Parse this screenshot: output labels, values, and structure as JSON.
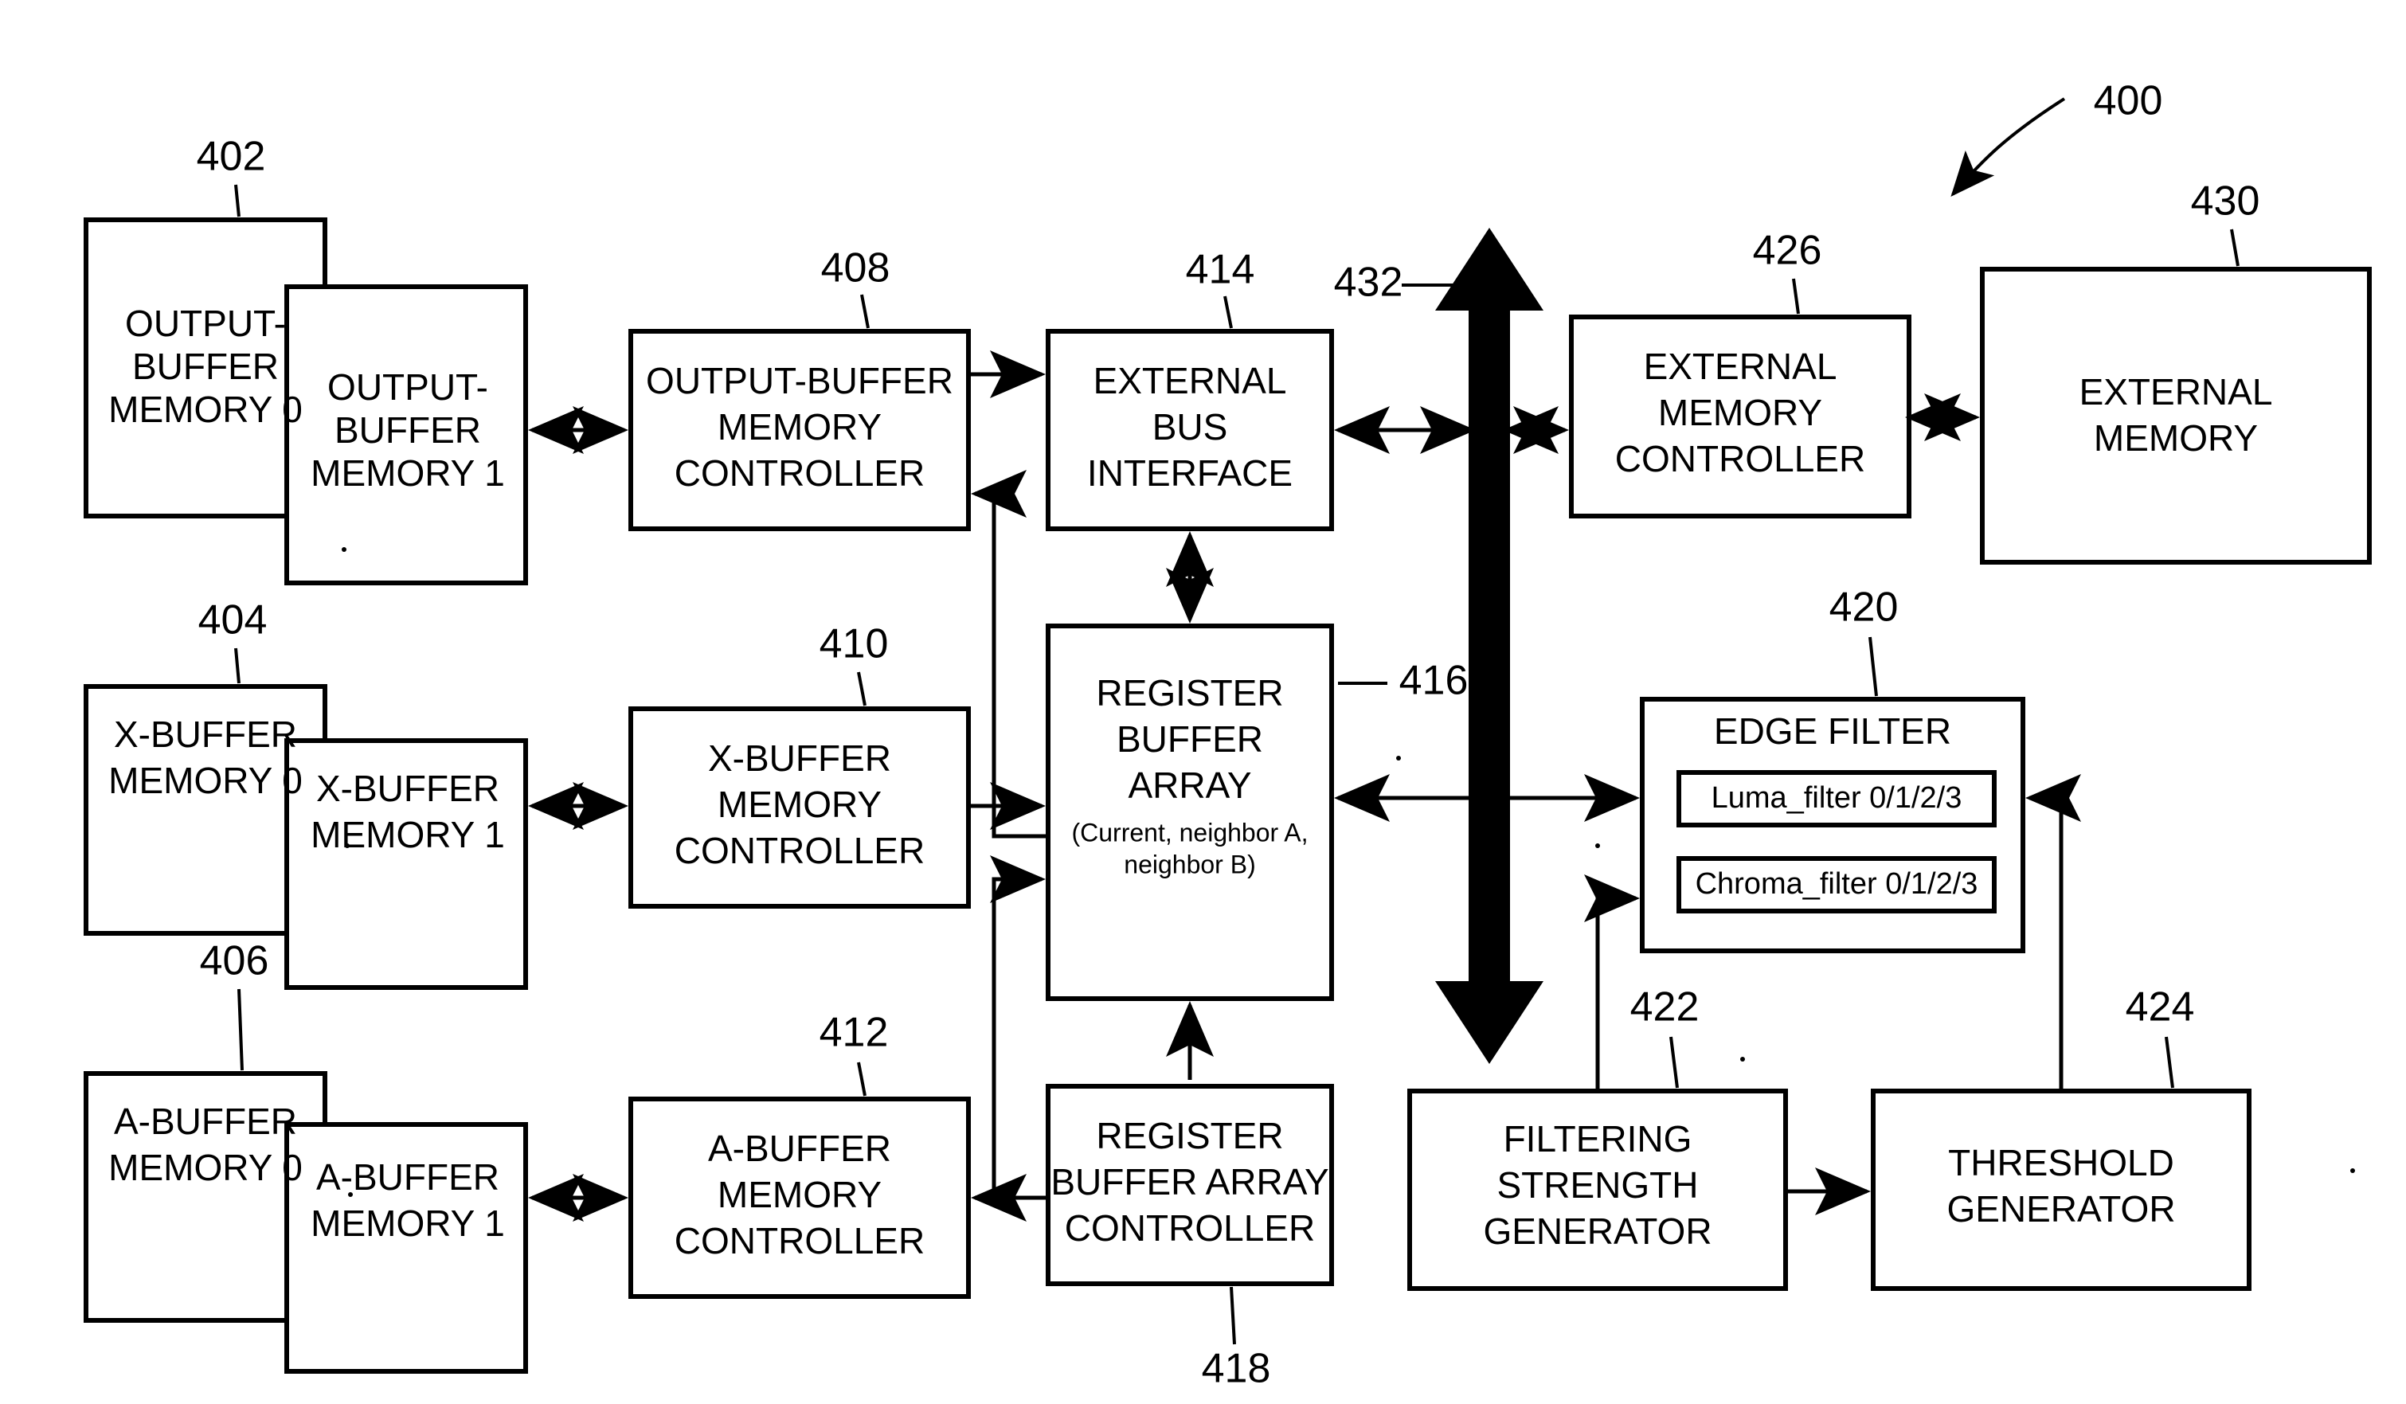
{
  "figure": {
    "overall_ref": "400",
    "type": "patent-block-diagram",
    "title_text": ""
  },
  "blocks": [
    {
      "id": "output_buffer_memory_0",
      "label_lines": [
        "OUTPUT-",
        "BUFFER",
        "MEMORY 0"
      ],
      "ref": "402"
    },
    {
      "id": "output_buffer_memory_1",
      "label_lines": [
        "OUTPUT-",
        "BUFFER",
        "MEMORY 1"
      ],
      "ref": ""
    },
    {
      "id": "output_buffer_memory_controller",
      "label_lines": [
        "OUTPUT-BUFFER",
        "MEMORY",
        "CONTROLLER"
      ],
      "ref": "408"
    },
    {
      "id": "external_bus_interface",
      "label_lines": [
        "EXTERNAL",
        "BUS",
        "INTERFACE"
      ],
      "ref": "414"
    },
    {
      "id": "external_memory_controller",
      "label_lines": [
        "EXTERNAL",
        "MEMORY",
        "CONTROLLER"
      ],
      "ref": "426"
    },
    {
      "id": "external_memory",
      "label_lines": [
        "EXTERNAL",
        "MEMORY"
      ],
      "ref": "430"
    },
    {
      "id": "x_buffer_memory_0",
      "label_lines": [
        "X-BUFFER",
        "MEMORY 0"
      ],
      "ref": "404"
    },
    {
      "id": "x_buffer_memory_1",
      "label_lines": [
        "X-BUFFER",
        "MEMORY 1"
      ],
      "ref": ""
    },
    {
      "id": "x_buffer_memory_controller",
      "label_lines": [
        "X-BUFFER",
        "MEMORY",
        "CONTROLLER"
      ],
      "ref": "410"
    },
    {
      "id": "register_buffer_array",
      "label_lines": [
        "REGISTER",
        "BUFFER",
        "ARRAY"
      ],
      "sub_lines": [
        "(Current, neighbor A,",
        "neighbor B)"
      ],
      "ref": "416"
    },
    {
      "id": "edge_filter",
      "label_lines": [
        "EDGE FILTER"
      ],
      "ref": "420"
    },
    {
      "id": "luma_filter",
      "label_lines": [
        "Luma_filter 0/1/2/3"
      ],
      "ref": ""
    },
    {
      "id": "chroma_filter",
      "label_lines": [
        "Chroma_filter 0/1/2/3"
      ],
      "ref": ""
    },
    {
      "id": "a_buffer_memory_0",
      "label_lines": [
        "A-BUFFER",
        "MEMORY 0"
      ],
      "ref": "406"
    },
    {
      "id": "a_buffer_memory_1",
      "label_lines": [
        "A-BUFFER",
        "MEMORY 1"
      ],
      "ref": ""
    },
    {
      "id": "a_buffer_memory_controller",
      "label_lines": [
        "A-BUFFER",
        "MEMORY",
        "CONTROLLER"
      ],
      "ref": "412"
    },
    {
      "id": "register_buffer_array_controller",
      "label_lines": [
        "REGISTER",
        "BUFFER ARRAY",
        "CONTROLLER"
      ],
      "ref": "418"
    },
    {
      "id": "filtering_strength_generator",
      "label_lines": [
        "FILTERING",
        "STRENGTH",
        "GENERATOR"
      ],
      "ref": "422"
    },
    {
      "id": "threshold_generator",
      "label_lines": [
        "THRESHOLD",
        "GENERATOR"
      ],
      "ref": "424"
    }
  ],
  "labels": {
    "obm0_l1": "OUTPUT-",
    "obm0_l2": "BUFFER",
    "obm0_l3": "MEMORY 0",
    "obm1_l1": "OUTPUT-",
    "obm1_l2": "BUFFER",
    "obm1_l3": "MEMORY 1",
    "obmc_l1": "OUTPUT-BUFFER",
    "obmc_l2": "MEMORY",
    "obmc_l3": "CONTROLLER",
    "ebi_l1": "EXTERNAL",
    "ebi_l2": "BUS",
    "ebi_l3": "INTERFACE",
    "emc_l1": "EXTERNAL",
    "emc_l2": "MEMORY",
    "emc_l3": "CONTROLLER",
    "em_l1": "EXTERNAL",
    "em_l2": "MEMORY",
    "xbm0_l1": "X-BUFFER",
    "xbm0_l2": "MEMORY 0",
    "xbm1_l1": "X-BUFFER",
    "xbm1_l2": "MEMORY 1",
    "xbmc_l1": "X-BUFFER",
    "xbmc_l2": "MEMORY",
    "xbmc_l3": "CONTROLLER",
    "rba_l1": "REGISTER",
    "rba_l2": "BUFFER",
    "rba_l3": "ARRAY",
    "rba_s1": "(Current, neighbor A,",
    "rba_s2": "neighbor B)",
    "ef_l1": "EDGE FILTER",
    "luma": "Luma_filter 0/1/2/3",
    "chroma": "Chroma_filter 0/1/2/3",
    "abm0_l1": "A-BUFFER",
    "abm0_l2": "MEMORY 0",
    "abm1_l1": "A-BUFFER",
    "abm1_l2": "MEMORY 1",
    "abmc_l1": "A-BUFFER",
    "abmc_l2": "MEMORY",
    "abmc_l3": "CONTROLLER",
    "rbac_l1": "REGISTER",
    "rbac_l2": "BUFFER ARRAY",
    "rbac_l3": "CONTROLLER",
    "fsg_l1": "FILTERING",
    "fsg_l2": "STRENGTH",
    "fsg_l3": "GENERATOR",
    "tg_l1": "THRESHOLD",
    "tg_l2": "GENERATOR"
  },
  "reference_numerals": {
    "r400": "400",
    "r402": "402",
    "r404": "404",
    "r406": "406",
    "r408": "408",
    "r410": "410",
    "r412": "412",
    "r414": "414",
    "r416": "416",
    "r418": "418",
    "r420": "420",
    "r422": "422",
    "r424": "424",
    "r426": "426",
    "r430": "430",
    "r432": "432"
  },
  "colors": {
    "stroke": "#000000",
    "fill": "#ffffff"
  }
}
